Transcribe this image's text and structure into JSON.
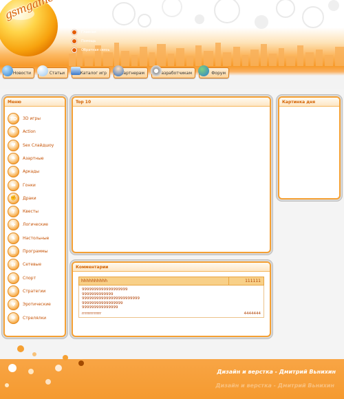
{
  "logo": {
    "text": "gsmgame.ru"
  },
  "quick_links": [
    {
      "label": "Главная"
    },
    {
      "label": "Помощь"
    },
    {
      "label": "Обратная связь"
    }
  ],
  "nav": [
    {
      "label": "Новости",
      "icon": "globe-icon"
    },
    {
      "label": "Статьи",
      "icon": "speech-bubble-icon"
    },
    {
      "label": "Каталог игр",
      "icon": "monitor-icon"
    },
    {
      "label": "Партнерам",
      "icon": "person-icon"
    },
    {
      "label": "Разработчикам",
      "icon": "gear-icon"
    },
    {
      "label": "Форум",
      "icon": "people-icon"
    }
  ],
  "menu": {
    "title": "Меню",
    "items": [
      {
        "label": "3D игры",
        "icon": "3d-icon",
        "glyph": "3D"
      },
      {
        "label": "Action",
        "icon": "gun-icon",
        "glyph": "✦"
      },
      {
        "label": "Sex Слайдшоу",
        "icon": "lips-icon",
        "glyph": "♥"
      },
      {
        "label": "Азартные",
        "icon": "dice-icon",
        "glyph": "♠"
      },
      {
        "label": "Аркады",
        "icon": "star-icon",
        "glyph": "★"
      },
      {
        "label": "Гонки",
        "icon": "car-icon",
        "glyph": "▬"
      },
      {
        "label": "Драки",
        "icon": "fist-icon",
        "glyph": "✊"
      },
      {
        "label": "Квесты",
        "icon": "scroll-icon",
        "glyph": "?"
      },
      {
        "label": "Логические",
        "icon": "puzzle-icon",
        "glyph": "✚"
      },
      {
        "label": "Настольные",
        "icon": "chess-icon",
        "glyph": "♞"
      },
      {
        "label": "Программы",
        "icon": "program-icon",
        "glyph": "▤"
      },
      {
        "label": "Сетевые",
        "icon": "network-icon",
        "glyph": "⇄"
      },
      {
        "label": "Спорт",
        "icon": "ball-icon",
        "glyph": "●"
      },
      {
        "label": "Стратегии",
        "icon": "strategy-icon",
        "glyph": "♜"
      },
      {
        "label": "Эротические",
        "icon": "heart-icon",
        "glyph": "♥"
      },
      {
        "label": "Стрелялки",
        "icon": "crosshair-icon",
        "glyph": "⊕"
      }
    ]
  },
  "top10": {
    "title": "Top 10"
  },
  "picture_of_day": {
    "title": "Картинка дня"
  },
  "comments": {
    "title": "Комментарии",
    "author": "hhhhhhhhhh",
    "number": "111111",
    "lines": [
      "9999999999999999999",
      "9999999999999",
      "999999999999999999999999",
      "99999999999999999",
      "999999999999999"
    ],
    "footer_left": "rrrrrrrrrrrrr",
    "footer_right": "4444444"
  },
  "footer": {
    "credit": "Дизайн и верстка - Дмитрий Вьнихин"
  },
  "colors": {
    "accent": "#f79a2a",
    "accent_dark": "#d36200",
    "text_orange": "#c55000"
  }
}
